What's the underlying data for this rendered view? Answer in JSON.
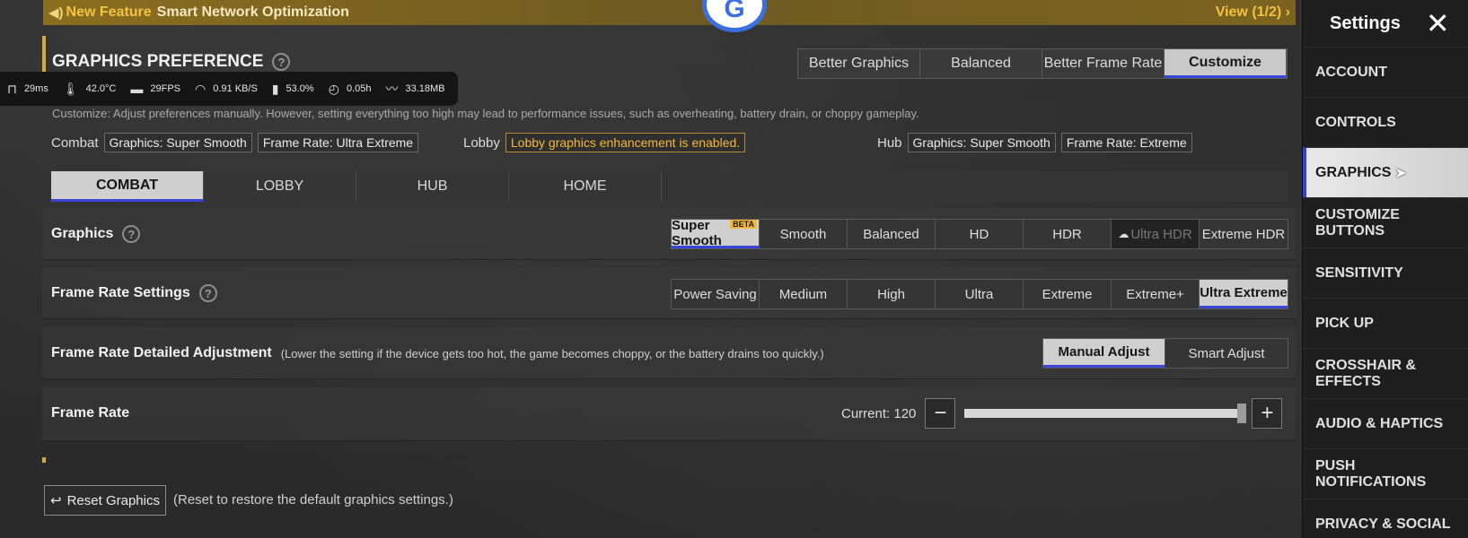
{
  "banner": {
    "new_feature": "New Feature",
    "title": "Smart Network Optimization",
    "view": "View (1/2) ›"
  },
  "badge": {
    "letter": "G"
  },
  "header": {
    "title": "GRAPHICS PREFERENCE",
    "help": "?"
  },
  "presets": [
    "Better Graphics",
    "Balanced",
    "Better Frame Rate",
    "Customize"
  ],
  "presets_selected": "Customize",
  "stats": {
    "ping": "29ms",
    "temp": "42.0°C",
    "fps": "29FPS",
    "net": "0.91 KB/S",
    "battery": "53.0%",
    "time": "0.05h",
    "mem": "33.18MB"
  },
  "description": "Customize: Adjust preferences manually. However, setting everything too high may lead to performance issues, such as overheating, battery drain, or choppy gameplay.",
  "summary": {
    "combat_label": "Combat",
    "combat_graphics": "Graphics: Super Smooth",
    "combat_fps": "Frame Rate: Ultra Extreme",
    "lobby_label": "Lobby",
    "lobby_note": "Lobby graphics enhancement is enabled.",
    "hub_label": "Hub",
    "hub_graphics": "Graphics: Super Smooth",
    "hub_fps": "Frame Rate: Extreme"
  },
  "tabs": [
    "COMBAT",
    "LOBBY",
    "HUB",
    "HOME"
  ],
  "graphics": {
    "label": "Graphics",
    "help": "?",
    "beta": "BETA",
    "options": [
      "Super Smooth",
      "Smooth",
      "Balanced",
      "HD",
      "HDR",
      "Ultra HDR",
      "Extreme HDR"
    ]
  },
  "frame_rate_settings": {
    "label": "Frame Rate Settings",
    "help": "?",
    "options": [
      "Power Saving",
      "Medium",
      "High",
      "Ultra",
      "Extreme",
      "Extreme+",
      "Ultra Extreme"
    ]
  },
  "detailed": {
    "label": "Frame Rate Detailed Adjustment",
    "sub": "(Lower the setting if the device gets too hot, the game becomes choppy, or the battery drains too quickly.)",
    "options": [
      "Manual Adjust",
      "Smart Adjust"
    ]
  },
  "frame_rate": {
    "label": "Frame Rate",
    "current": "Current: 120",
    "minus": "−",
    "plus": "+",
    "level": 1.0
  },
  "reset": {
    "label": "Reset Graphics",
    "note": "(Reset to restore the default graphics settings.)"
  },
  "sidebar": {
    "title": "Settings",
    "items": [
      "ACCOUNT",
      "CONTROLS",
      "GRAPHICS",
      "CUSTOMIZE BUTTONS",
      "SENSITIVITY",
      "PICK UP",
      "CROSSHAIR & EFFECTS",
      "AUDIO & HAPTICS",
      "PUSH NOTIFICATIONS",
      "PRIVACY & SOCIAL"
    ]
  },
  "colors": {
    "accent": "#3746d6",
    "gold": "#f4b83a"
  }
}
